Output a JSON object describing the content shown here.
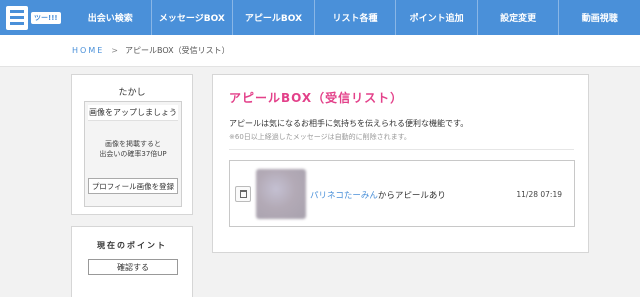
{
  "colors": {
    "nav_bg": "#4a90d9",
    "accent_pink": "#e3418a",
    "link_blue": "#4a90d9"
  },
  "logo": {
    "tag": "ツー!!!"
  },
  "nav": [
    "出会い検索",
    "メッセージBOX",
    "アピールBOX",
    "リスト各種",
    "ポイント追加",
    "設定変更",
    "動画視聴"
  ],
  "breadcrumb": {
    "home": "HOME",
    "separator": ">",
    "current": "アピールBOX（受信リスト）"
  },
  "user": {
    "name": "たかし",
    "photo_title": "画像をアップしましょう",
    "photo_text_1": "画像を掲載すると",
    "photo_text_2": "出会いの確率37倍UP",
    "photo_button": "プロフィール画像を登録"
  },
  "points": {
    "title": "現在のポイント",
    "button": "確認する"
  },
  "main": {
    "title": "アピールBOX（受信リスト）",
    "description": "アピールは気になるお相手に気持ちを伝えられる便利な機能です。",
    "note": "※60日以上経過したメッセージは自動的に削除されます。",
    "items": [
      {
        "user": "パリネコたーみん",
        "text": "からアピールあり",
        "time": "11/28 07:19",
        "icon": "trash-icon"
      }
    ]
  }
}
